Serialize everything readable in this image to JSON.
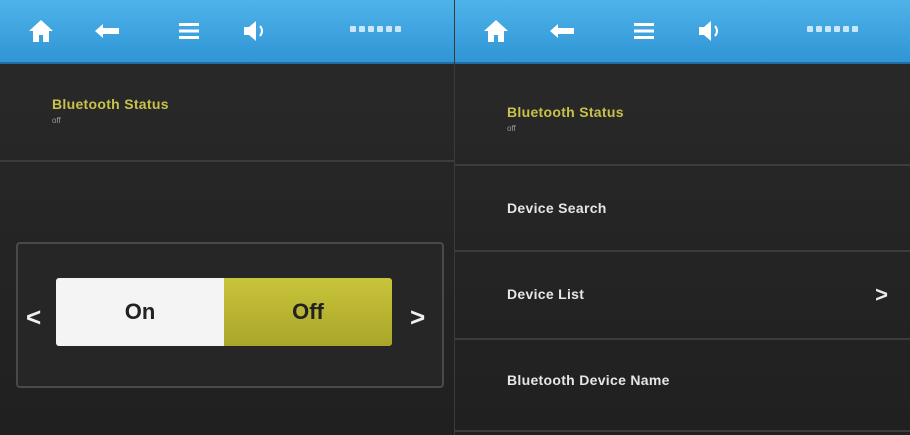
{
  "left_screen": {
    "topbar": {
      "icons": [
        "home-icon",
        "back-icon",
        "menu-icon",
        "volume-icon"
      ]
    },
    "status_row": {
      "title": "Bluetooth Status",
      "subtitle": "off"
    },
    "toggle": {
      "on_label": "On",
      "off_label": "Off",
      "selected": "Off",
      "prev_arrow": "<",
      "next_arrow": ">"
    }
  },
  "right_screen": {
    "topbar": {
      "icons": [
        "home-icon",
        "back-icon",
        "menu-icon",
        "volume-icon"
      ]
    },
    "menu": {
      "status_title": "Bluetooth Status",
      "status_subtitle": "off",
      "device_search": "Device Search",
      "device_list": "Device List",
      "device_list_arrow": ">",
      "device_name": "Bluetooth Device Name"
    }
  },
  "colors": {
    "topbar": "#3aa5e2",
    "accent": "#c8c43a",
    "background": "#242424"
  }
}
